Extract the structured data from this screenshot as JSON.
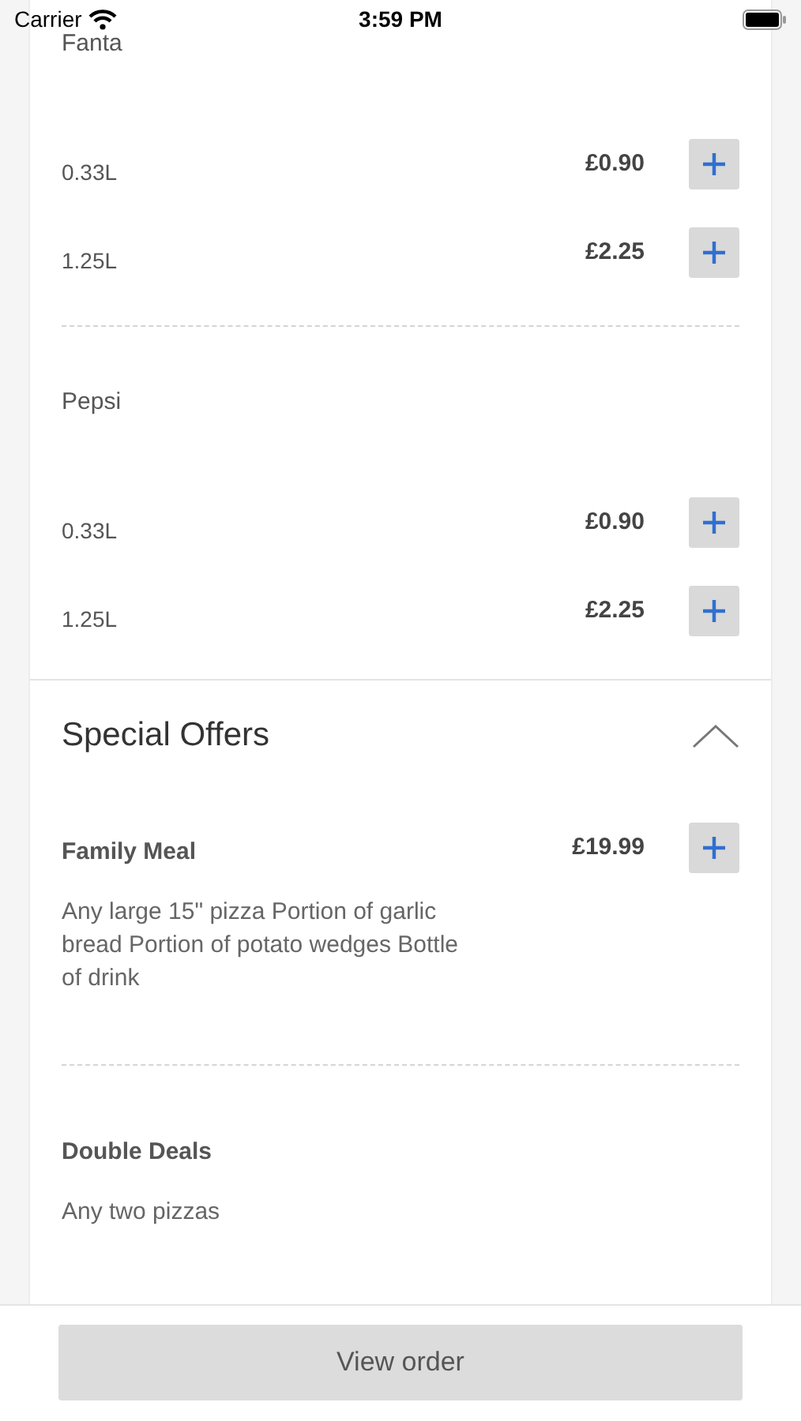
{
  "status_bar": {
    "carrier": "Carrier",
    "time": "3:59 PM"
  },
  "drinks": [
    {
      "name": "Fanta",
      "variants": [
        {
          "size": "0.33L",
          "price": "£0.90"
        },
        {
          "size": "1.25L",
          "price": "£2.25"
        }
      ]
    },
    {
      "name": "Pepsi",
      "variants": [
        {
          "size": "0.33L",
          "price": "£0.90"
        },
        {
          "size": "1.25L",
          "price": "£2.25"
        }
      ]
    }
  ],
  "special_offers": {
    "title": "Special Offers",
    "expanded": true,
    "items": [
      {
        "name": "Family Meal",
        "price": "£19.99",
        "description": "Any large 15\" pizza Portion of garlic bread Portion of potato wedges Bottle of drink"
      },
      {
        "name": "Double Deals",
        "description": "Any two pizzas"
      }
    ]
  },
  "view_order_button": "View order"
}
